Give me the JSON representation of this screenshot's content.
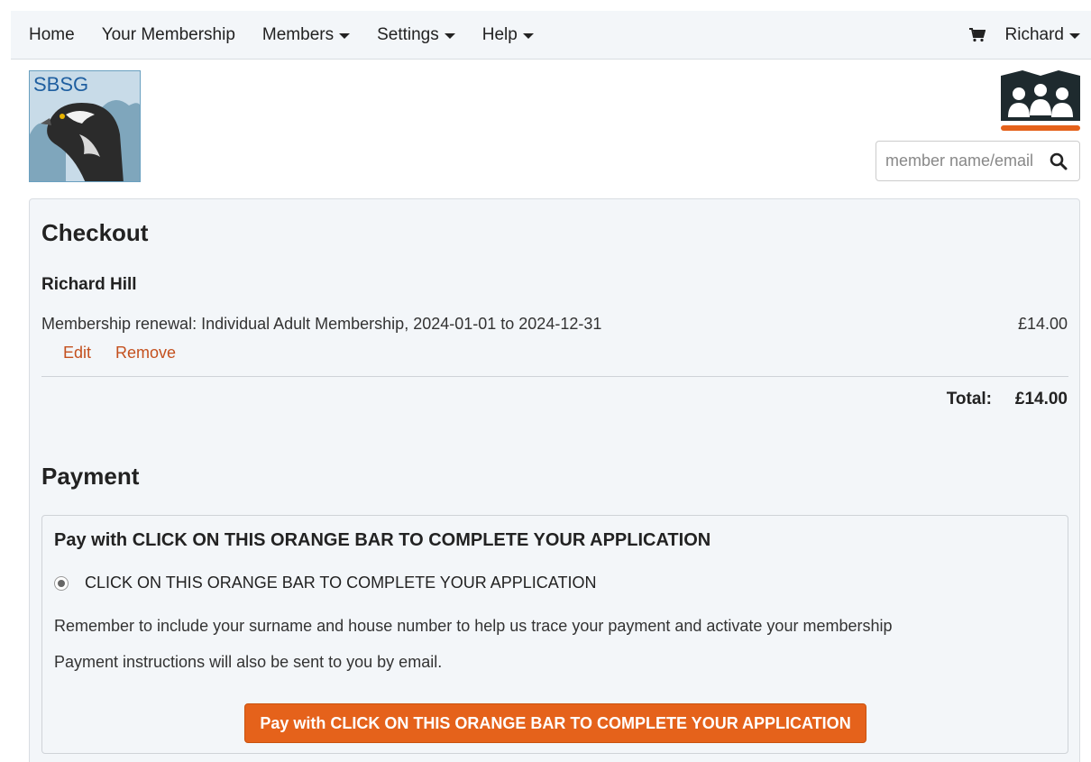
{
  "nav": {
    "items": [
      {
        "label": "Home",
        "dropdown": false
      },
      {
        "label": "Your Membership",
        "dropdown": false
      },
      {
        "label": "Members",
        "dropdown": true
      },
      {
        "label": "Settings",
        "dropdown": true
      },
      {
        "label": "Help",
        "dropdown": true
      }
    ],
    "cart_icon": "shopping-cart-icon",
    "user_label": "Richard"
  },
  "logo": {
    "text": "SBSG"
  },
  "search": {
    "placeholder": "member name/email",
    "icon": "search-icon"
  },
  "checkout": {
    "title": "Checkout",
    "member_name": "Richard Hill",
    "line_item": {
      "description": "Membership renewal: Individual Adult Membership, 2024-01-01 to 2024-12-31",
      "price": "£14.00",
      "edit_label": "Edit",
      "remove_label": "Remove"
    },
    "total_label": "Total:",
    "total_value": "£14.00"
  },
  "payment": {
    "title": "Payment",
    "heading": "Pay with CLICK ON THIS ORANGE BAR TO COMPLETE YOUR APPLICATION",
    "option_label": "CLICK ON THIS ORANGE BAR TO COMPLETE YOUR APPLICATION",
    "note_1": "Remember to include your surname and house number to help us trace your payment and activate your membership",
    "note_2": "Payment instructions will also be sent to you by email.",
    "button_label": "Pay with CLICK ON THIS ORANGE BAR TO COMPLETE YOUR APPLICATION"
  },
  "colors": {
    "accent": "#e5621b",
    "link": "#c4501e",
    "panel_bg": "#f3f6f9"
  }
}
